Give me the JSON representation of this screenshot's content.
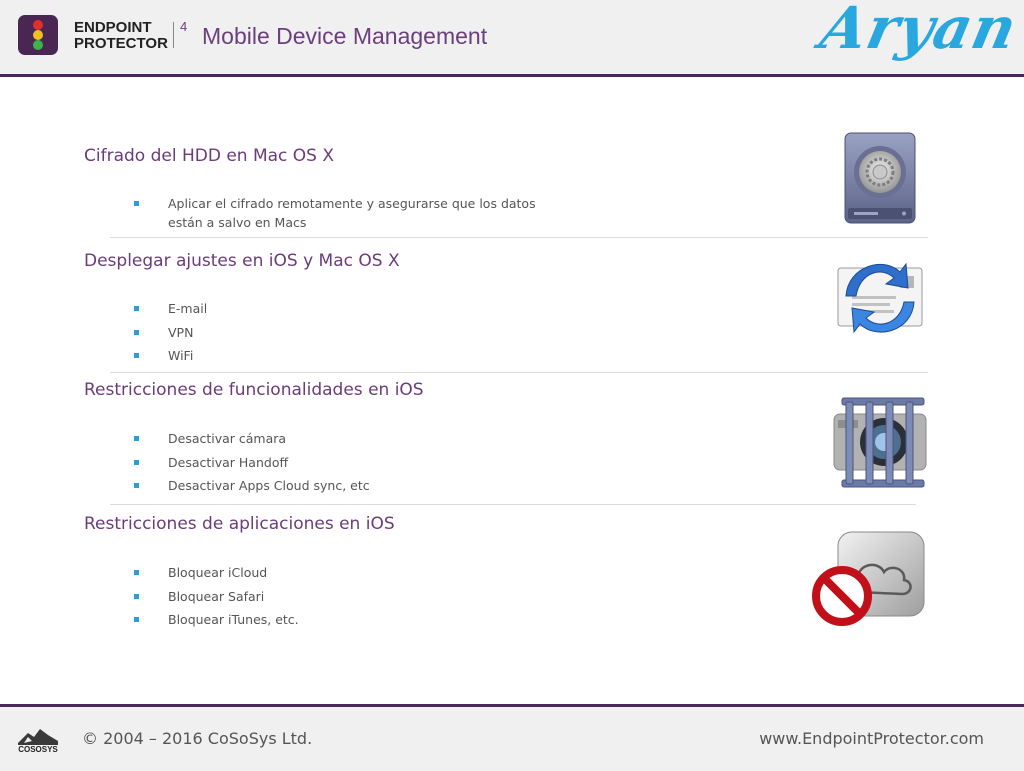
{
  "header": {
    "brand_line1": "ENDPOINT",
    "brand_line2": "PROTECTOR",
    "version": "4",
    "title": "Mobile Device Management",
    "signature": "Aryan"
  },
  "sections": [
    {
      "title": "Cifrado del HDD en Mac OS X",
      "icon": "hdd-vault-icon",
      "items": [
        "Aplicar el cifrado remotamente y asegurarse que los datos están a salvo en Macs"
      ]
    },
    {
      "title": "Desplegar ajustes en iOS y Mac OS X",
      "icon": "mail-sync-icon",
      "items": [
        "E-mail",
        "VPN",
        "WiFi"
      ]
    },
    {
      "title": "Restricciones de funcionalidades en iOS",
      "icon": "caged-camera-icon",
      "items": [
        "Desactivar cámara",
        "Desactivar Handoff",
        "Desactivar Apps Cloud sync, etc"
      ]
    },
    {
      "title": "Restricciones de aplicaciones en iOS",
      "icon": "icloud-blocked-icon",
      "items": [
        "Bloquear iCloud",
        "Bloquear Safari",
        "Bloquear iTunes, etc."
      ]
    }
  ],
  "footer": {
    "logo_text": "COSOSYS",
    "copyright": "© 2004 – 2016 CoSoSys Ltd.",
    "website": "www.EndpointProtector.com"
  },
  "colors": {
    "accent_purple": "#6b3b7b",
    "bullet_blue": "#2a9fd6",
    "signature_blue": "#29a7df"
  }
}
